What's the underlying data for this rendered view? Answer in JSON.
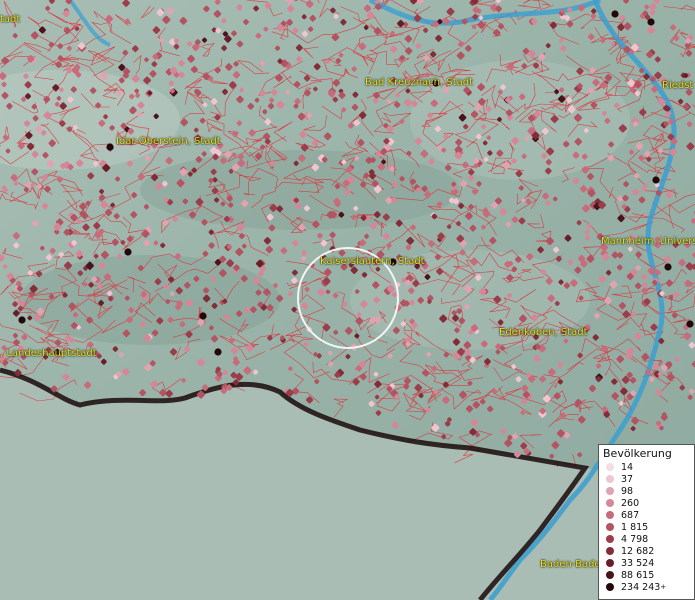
{
  "map": {
    "place_labels": [
      {
        "id": "tl",
        "text": "tadt"
      },
      {
        "id": "bk",
        "text": "Bad Kreuznach, Stadt"
      },
      {
        "id": "ri",
        "text": "Riedst"
      },
      {
        "id": "io",
        "text": "Idar-Oberstein, Stadt"
      },
      {
        "id": "ka",
        "text": "Kaiserslautern, Stadt"
      },
      {
        "id": "ma",
        "text": "Mannheim, Univers"
      },
      {
        "id": "la",
        "text": ", Landeshauptstadt"
      },
      {
        "id": "ed",
        "text": "Edenkoben, Stadt"
      },
      {
        "id": "bb",
        "text": "Baden-Bade"
      }
    ],
    "colors": {
      "boundary": "#e0303a",
      "river": "#3a9fd0",
      "border": "#1a0a0a",
      "label": "#e6e21c"
    }
  },
  "legend": {
    "title": "Bevölkerung",
    "items": [
      {
        "label": "14",
        "color": "#f6dde4"
      },
      {
        "label": "37",
        "color": "#efc6d0"
      },
      {
        "label": "98",
        "color": "#e2a3b1"
      },
      {
        "label": "260",
        "color": "#d68797"
      },
      {
        "label": "687",
        "color": "#c86c7c"
      },
      {
        "label": "1 815",
        "color": "#b25462"
      },
      {
        "label": "4 798",
        "color": "#9b3e4b"
      },
      {
        "label": "12 682",
        "color": "#822d38"
      },
      {
        "label": "33 524",
        "color": "#661f28"
      },
      {
        "label": "88 615",
        "color": "#48131a"
      },
      {
        "label": "234 243",
        "color": "#260709",
        "plus": "+"
      }
    ]
  }
}
